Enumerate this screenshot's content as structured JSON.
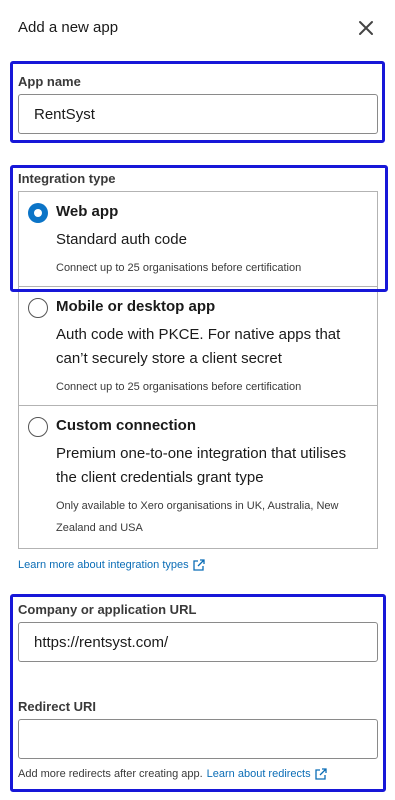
{
  "header": {
    "title": "Add a new app",
    "close_icon": "close-icon"
  },
  "app_name": {
    "label": "App name",
    "value": "RentSyst"
  },
  "integration": {
    "label": "Integration type",
    "options": [
      {
        "title": "Web app",
        "description": "Standard auth code",
        "note": "Connect up to 25 organisations before certification",
        "selected": true
      },
      {
        "title": "Mobile or desktop app",
        "description": "Auth code with PKCE. For native apps that can’t securely store a client secret",
        "note": "Connect up to 25 organisations before certification",
        "selected": false
      },
      {
        "title": "Custom connection",
        "description": "Premium one-to-one integration that utilises the client credentials grant type",
        "note": "Only available to Xero organisations in UK, Australia, New Zealand and USA",
        "selected": false
      }
    ],
    "learn_more": "Learn more about integration types"
  },
  "company_url": {
    "label": "Company or application URL",
    "value": "https://rentsyst.com/"
  },
  "redirect": {
    "label": "Redirect URI",
    "value": "",
    "helper": "Add more redirects after creating app.",
    "learn_link": "Learn about redirects"
  },
  "colors": {
    "accent": "#0b74c7",
    "highlight": "#1717d8",
    "link": "#0b6db6"
  },
  "icons": {
    "external": "external-link-icon",
    "close": "close-icon"
  }
}
